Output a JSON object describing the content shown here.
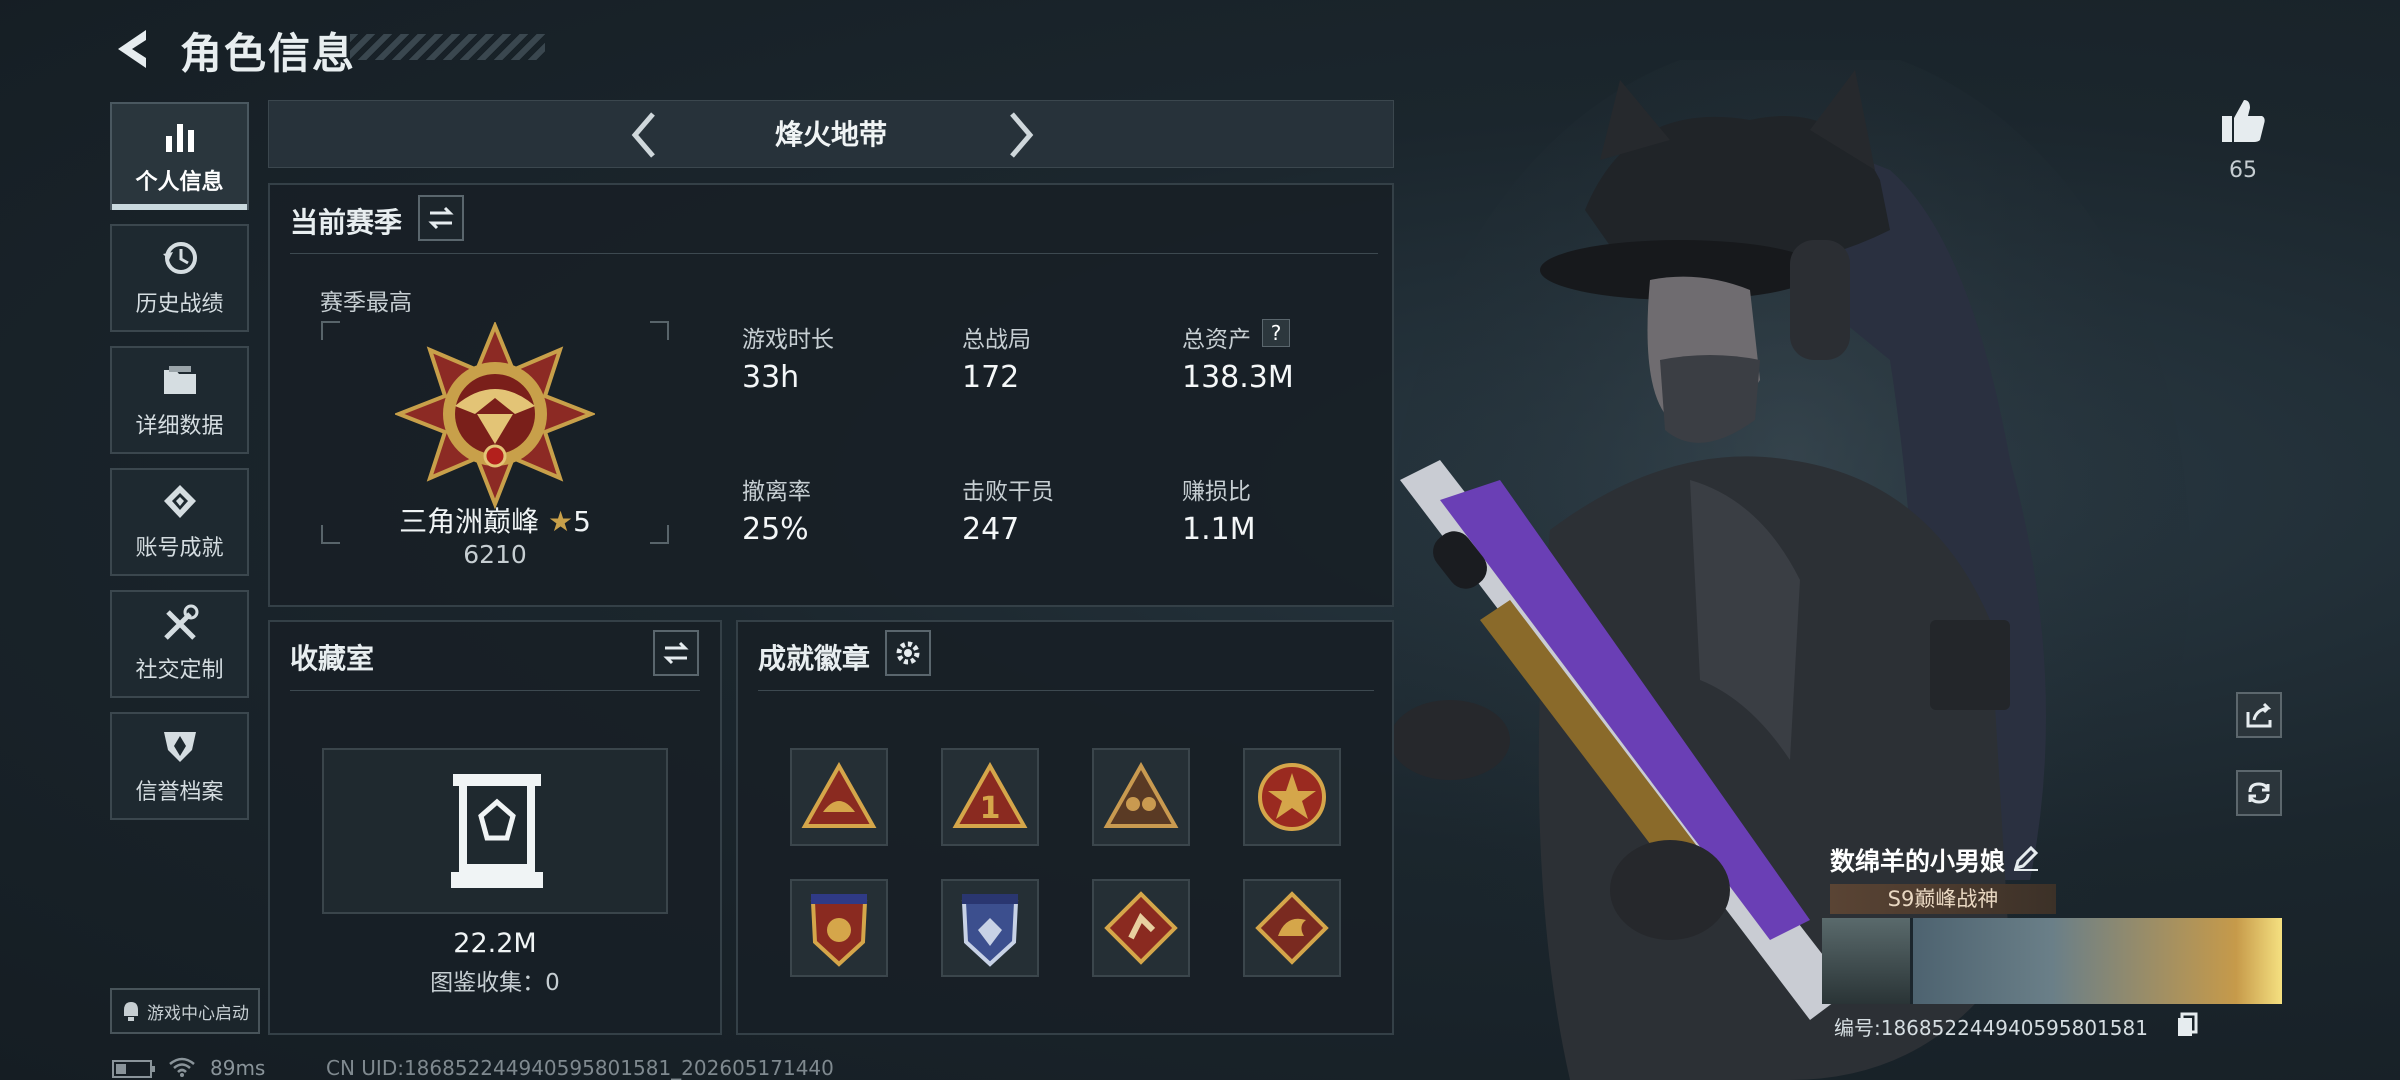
{
  "header": {
    "title": "角色信息"
  },
  "nav": [
    {
      "label": "个人信息",
      "icon": "bar-chart-icon",
      "active": true
    },
    {
      "label": "历史战绩",
      "icon": "history-icon"
    },
    {
      "label": "详细数据",
      "icon": "folder-icon"
    },
    {
      "label": "账号成就",
      "icon": "achievement-icon"
    },
    {
      "label": "社交定制",
      "icon": "tools-icon"
    },
    {
      "label": "信誉档案",
      "icon": "shield-icon"
    }
  ],
  "season": {
    "name": "烽火地带"
  },
  "current_season": {
    "title": "当前赛季",
    "best_label": "赛季最高",
    "rank_name": "三角洲巅峰",
    "rank_stars": "5",
    "rank_score": "6210",
    "stats": [
      {
        "label": "游戏时长",
        "value": "33h"
      },
      {
        "label": "总战局",
        "value": "172"
      },
      {
        "label": "总资产",
        "value": "138.3M"
      },
      {
        "label": "撤离率",
        "value": "25%"
      },
      {
        "label": "击败干员",
        "value": "247"
      },
      {
        "label": "赚损比",
        "value": "1.1M"
      }
    ],
    "help_mark": "?"
  },
  "collection": {
    "title": "收藏室",
    "value": "22.2M",
    "sub": "图鉴收集：0"
  },
  "badges": {
    "title": "成就徽章"
  },
  "right": {
    "likes": "65"
  },
  "player": {
    "name": "数绵羊的小男娘",
    "title_badge": "S9巅峰战神",
    "id_line": "编号:1868522449405958015​81"
  },
  "footer": {
    "launch_button": "游戏中心启动",
    "ping": "89ms",
    "uid": "CN UID:1868522449405958015​81_202605171440"
  },
  "colors": {
    "accent": "#c9d9de",
    "panel": "#182026",
    "gold": "#c8a04a"
  }
}
